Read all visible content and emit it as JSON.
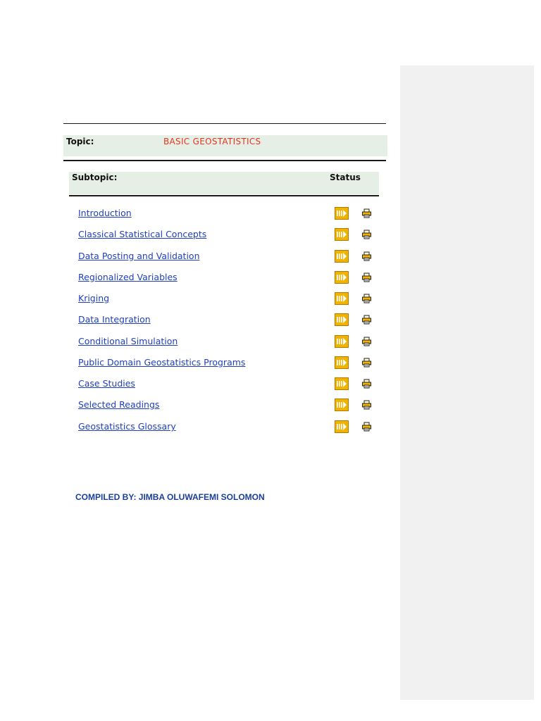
{
  "topic": {
    "label": "Topic:",
    "value": "BASIC GEOSTATISTICS"
  },
  "subtopic_header": {
    "label": "Subtopic:",
    "status_label": "Status"
  },
  "subtopics": [
    {
      "label": "Introduction",
      "status_icon": "arrow-icon",
      "action_icon": "print-icon"
    },
    {
      "label": "Classical Statistical Concepts",
      "status_icon": "arrow-icon",
      "action_icon": "print-icon"
    },
    {
      "label": "Data Posting and Validation",
      "status_icon": "arrow-icon",
      "action_icon": "print-icon"
    },
    {
      "label": "Regionalized Variables",
      "status_icon": "arrow-icon",
      "action_icon": "print-icon"
    },
    {
      "label": "Kriging",
      "status_icon": "arrow-icon",
      "action_icon": "print-icon"
    },
    {
      "label": "Data Integration",
      "status_icon": "arrow-icon",
      "action_icon": "print-icon"
    },
    {
      "label": "Conditional Simulation",
      "status_icon": "arrow-icon",
      "action_icon": "print-icon"
    },
    {
      "label": "Public Domain Geostatistics Programs",
      "status_icon": "arrow-icon",
      "action_icon": "print-icon"
    },
    {
      "label": "Case Studies",
      "status_icon": "arrow-icon",
      "action_icon": "print-icon"
    },
    {
      "label": "Selected Readings",
      "status_icon": "arrow-icon",
      "action_icon": "print-icon"
    },
    {
      "label": "Geostatistics Glossary",
      "status_icon": "arrow-icon",
      "action_icon": "print-icon"
    }
  ],
  "footer": {
    "compiled_by": "COMPILED BY: JIMBA OLUWAFEMI SOLOMON"
  },
  "colors": {
    "link": "#1f3fbf",
    "topic_value": "#e8351f",
    "header_bar": "#e6efe6",
    "compiled": "#1a3f99",
    "comment_pane": "#f1f1f1",
    "icon_gold": "#f0b400"
  }
}
